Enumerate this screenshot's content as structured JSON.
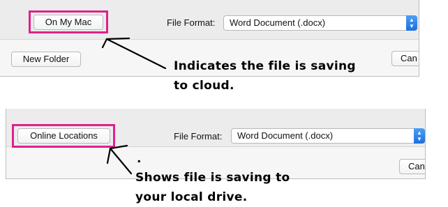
{
  "panel_top": {
    "location_button": "On My Mac",
    "file_format_label": "File Format:",
    "file_format_value": "Word Document (.docx)",
    "new_folder_button": "New Folder",
    "cancel_button": "Can",
    "note_line1": "Indicates the file is saving",
    "note_line2": "to cloud."
  },
  "panel_bottom": {
    "location_button": "Online Locations",
    "file_format_label": "File Format:",
    "file_format_value": "Word Document (.docx)",
    "cancel_button": "Can",
    "dot": ".",
    "note_line1": "Shows file is saving to",
    "note_line2": "your local drive."
  },
  "colors": {
    "highlight": "#e0218a",
    "stepper": "#1d6fe0"
  },
  "icons": {
    "stepper": "up-down-chevron-icon",
    "arrow": "hand-drawn-arrow-icon"
  }
}
